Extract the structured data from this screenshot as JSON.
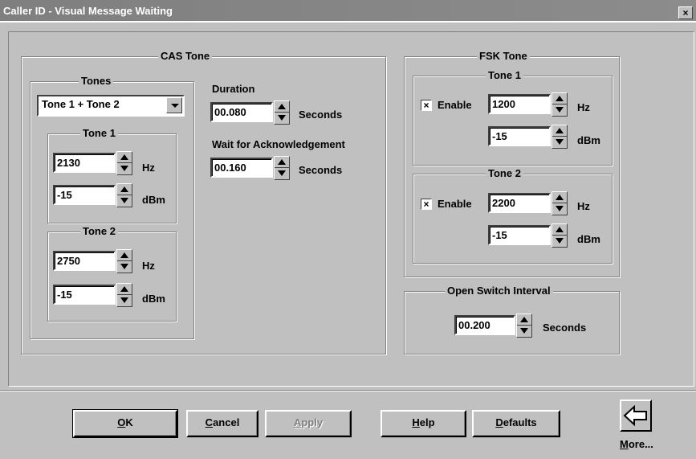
{
  "window": {
    "title": "Caller ID - Visual Message Waiting",
    "close_glyph": "×"
  },
  "cas": {
    "legend": "CAS Tone",
    "tones": {
      "legend": "Tones",
      "selected": "Tone 1 + Tone 2",
      "tone1": {
        "legend": "Tone 1",
        "hz_value": "2130",
        "hz_unit": "Hz",
        "db_value": "-15",
        "db_unit": "dBm"
      },
      "tone2": {
        "legend": "Tone 2",
        "hz_value": "2750",
        "hz_unit": "Hz",
        "db_value": "-15",
        "db_unit": "dBm"
      }
    },
    "duration": {
      "label": "Duration",
      "value": "00.080",
      "unit": "Seconds"
    },
    "wait": {
      "label": "Wait for Acknowledgement",
      "value": "00.160",
      "unit": "Seconds"
    }
  },
  "fsk": {
    "legend": "FSK Tone",
    "tone1": {
      "legend": "Tone 1",
      "enable_label": "Enable",
      "enabled": true,
      "hz_value": "1200",
      "hz_unit": "Hz",
      "db_value": "-15",
      "db_unit": "dBm"
    },
    "tone2": {
      "legend": "Tone 2",
      "enable_label": "Enable",
      "enabled": true,
      "hz_value": "2200",
      "hz_unit": "Hz",
      "db_value": "-15",
      "db_unit": "dBm"
    }
  },
  "osi": {
    "legend": "Open Switch Interval",
    "value": "00.200",
    "unit": "Seconds"
  },
  "buttons": {
    "ok": {
      "accel": "O",
      "rest": "K"
    },
    "cancel": {
      "accel": "C",
      "rest": "ancel"
    },
    "apply": {
      "accel": "A",
      "rest": "pply"
    },
    "help": {
      "accel": "H",
      "rest": "elp"
    },
    "defaults": {
      "accel": "D",
      "rest": "efaults"
    },
    "more": {
      "accel": "M",
      "rest": "ore..."
    }
  },
  "check_glyph": "×",
  "icons": [
    "close-icon",
    "dropdown-arrow-icon",
    "spin-up-icon",
    "spin-down-icon",
    "left-arrow-icon"
  ]
}
